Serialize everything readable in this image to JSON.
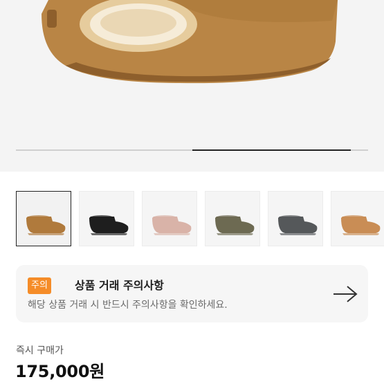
{
  "product": {
    "thumbnails": [
      {
        "icon": "boot-chestnut-icon",
        "color": "#b07a3c",
        "selected": true
      },
      {
        "icon": "boot-black-icon",
        "color": "#1e1e1e",
        "selected": false
      },
      {
        "icon": "boot-pink-icon",
        "color": "#d9b3a8",
        "selected": false
      },
      {
        "icon": "boot-olive-icon",
        "color": "#6d6a52",
        "selected": false
      },
      {
        "icon": "boot-grey-icon",
        "color": "#55585a",
        "selected": false
      },
      {
        "icon": "boot-sand-icon",
        "color": "#c98d55",
        "selected": false
      }
    ],
    "gallery_progress": 0.5
  },
  "notice": {
    "badge": "주의",
    "title": "상품 거래 주의사항",
    "description": "해당 상품 거래 시 반드시 주의사항을 확인하세요.",
    "arrow_icon": "arrow-right-icon",
    "badge_color": "#f58c28"
  },
  "price": {
    "label": "즉시 구매가",
    "value": "175,000원"
  }
}
